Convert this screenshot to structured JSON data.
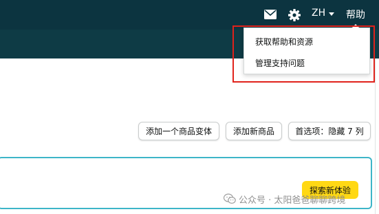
{
  "header": {
    "language": "ZH",
    "help": "帮助",
    "icons": {
      "mail": "mail-icon",
      "settings": "gear-icon",
      "caret": "caret-down-icon"
    }
  },
  "help_menu": {
    "items": [
      "获取帮助和资源",
      "管理支持问题"
    ]
  },
  "actions": {
    "add_variant": "添加一个商品变体",
    "add_new_product": "添加新商品",
    "preferences": "首选项：隐藏 7 列"
  },
  "panel": {
    "explore_button": "探索新体验"
  },
  "watermark": {
    "text": "公众号 · 太阳爸爸聊聊跨境"
  },
  "colors": {
    "topbar": "#0c3440",
    "subbar": "#0e3b45",
    "highlight": "#e0221b",
    "panel_border": "#3db5c8",
    "explore_button": "#ffd814"
  }
}
